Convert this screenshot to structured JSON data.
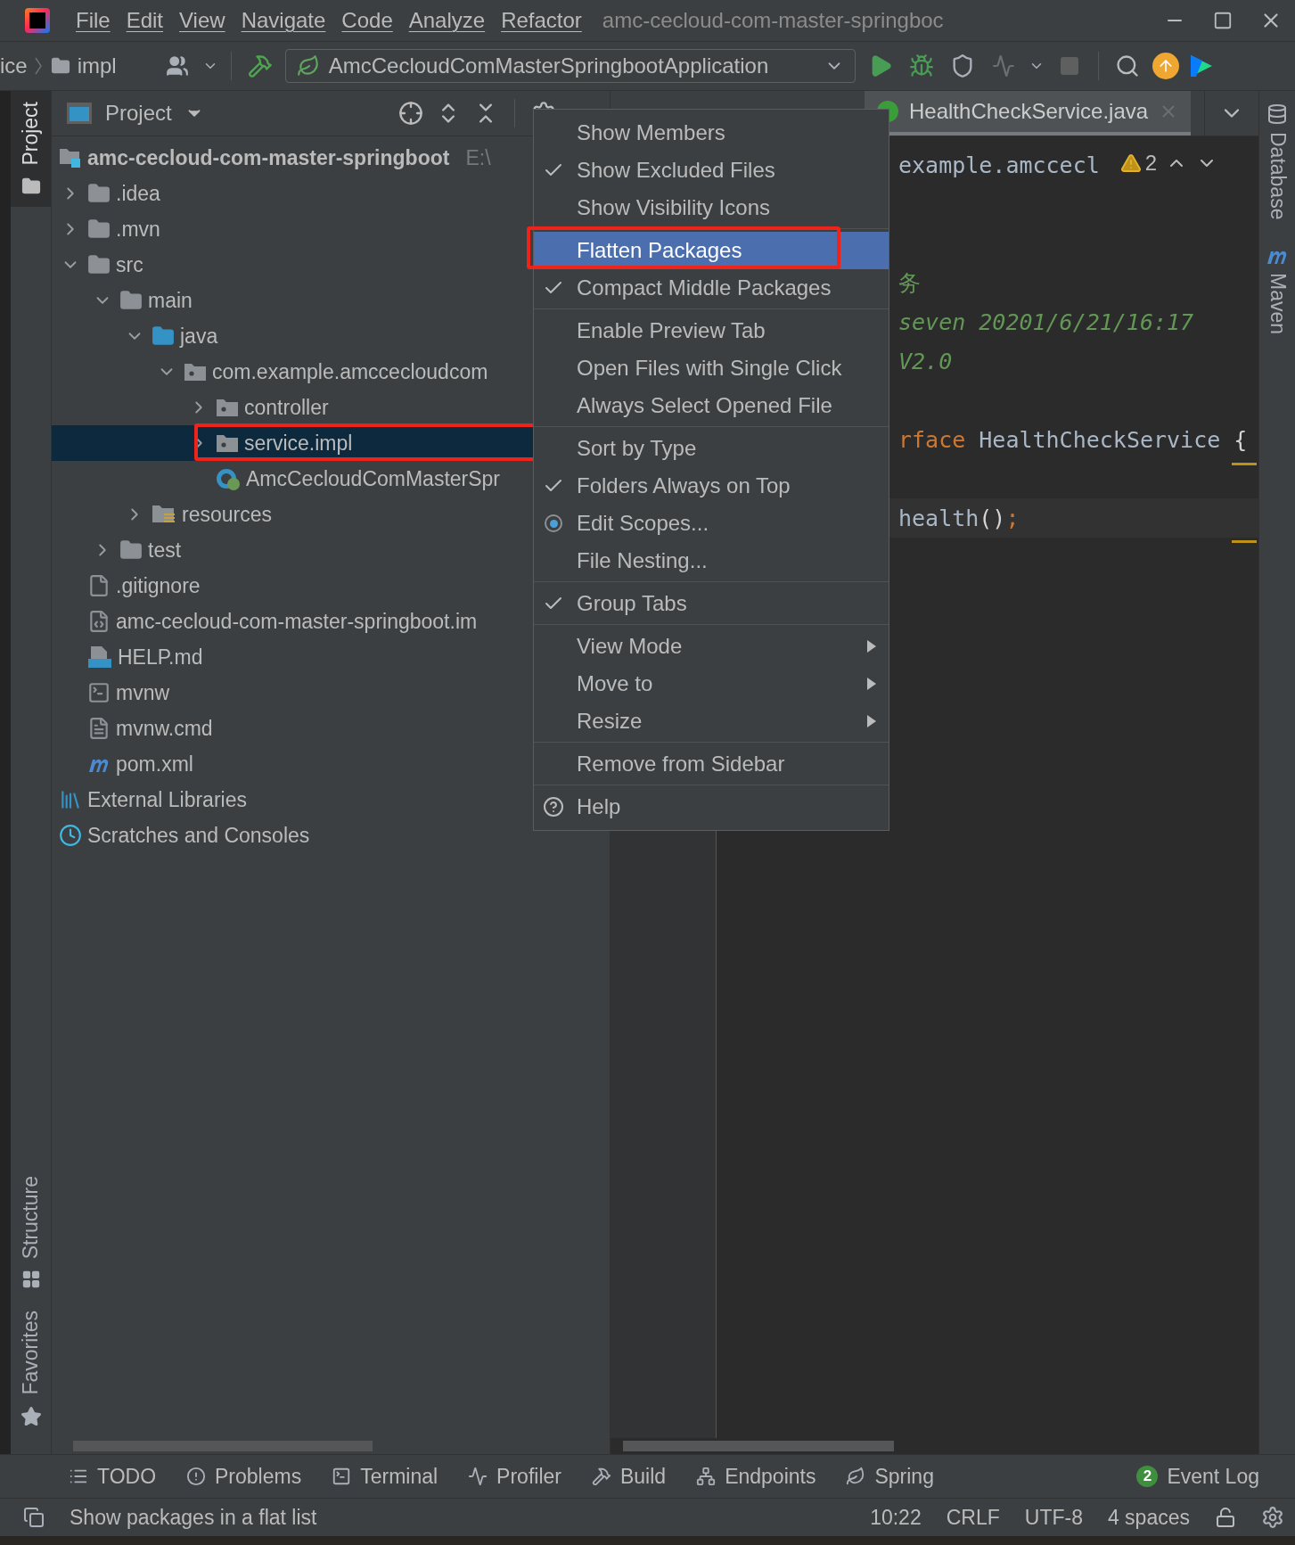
{
  "title_bar": {
    "menus": [
      "File",
      "Edit",
      "View",
      "Navigate",
      "Code",
      "Analyze",
      "Refactor"
    ],
    "title": "amc-cecloud-com-master-springboc"
  },
  "toolbar": {
    "breadcrumbs": [
      "ice",
      "impl"
    ],
    "run_configuration": "AmcCecloudComMasterSpringbootApplication"
  },
  "left_stripe": [
    {
      "label": "Project",
      "kind": "project",
      "selected": true
    },
    {
      "label": "Structure",
      "kind": "structure",
      "selected": false
    },
    {
      "label": "Favorites",
      "kind": "favorites",
      "selected": false
    }
  ],
  "project_panel": {
    "title": "Project",
    "tree": [
      {
        "label": "amc-cecloud-com-master-springboot",
        "hint": "E:\\",
        "kind": "project",
        "selected": false,
        "highlighted": false,
        "children": [
          {
            "label": ".idea",
            "kind": "folder",
            "expanded": false,
            "selected": false,
            "highlighted": false
          },
          {
            "label": ".mvn",
            "kind": "folder",
            "expanded": false,
            "selected": false,
            "highlighted": false
          },
          {
            "label": "src",
            "kind": "folder",
            "expanded": true,
            "selected": false,
            "highlighted": false,
            "children": [
              {
                "label": "main",
                "kind": "folder",
                "expanded": true,
                "selected": false,
                "highlighted": false,
                "children": [
                  {
                    "label": "java",
                    "kind": "source",
                    "expanded": true,
                    "selected": false,
                    "highlighted": false,
                    "children": [
                      {
                        "label": "com.example.amccecloudcom",
                        "kind": "package",
                        "expanded": true,
                        "selected": false,
                        "highlighted": false,
                        "children": [
                          {
                            "label": "controller",
                            "kind": "package",
                            "expanded": false,
                            "selected": false,
                            "highlighted": false
                          },
                          {
                            "label": "service.impl",
                            "kind": "package",
                            "expanded": false,
                            "selected": true,
                            "highlighted": true
                          },
                          {
                            "label": "AmcCecloudComMasterSpr",
                            "kind": "class",
                            "selected": false,
                            "highlighted": false
                          }
                        ]
                      }
                    ]
                  },
                  {
                    "label": "resources",
                    "kind": "resources",
                    "expanded": false,
                    "selected": false,
                    "highlighted": false
                  }
                ]
              },
              {
                "label": "test",
                "kind": "folder",
                "expanded": false,
                "selected": false,
                "highlighted": false
              }
            ]
          },
          {
            "label": ".gitignore",
            "kind": "file",
            "selected": false,
            "highlighted": false
          },
          {
            "label": "amc-cecloud-com-master-springboot.im",
            "kind": "module",
            "selected": false,
            "highlighted": false
          },
          {
            "label": "HELP.md",
            "kind": "markdown",
            "selected": false,
            "highlighted": false
          },
          {
            "label": "mvnw",
            "kind": "script",
            "selected": false,
            "highlighted": false
          },
          {
            "label": "mvnw.cmd",
            "kind": "text",
            "selected": false,
            "highlighted": false
          },
          {
            "label": "pom.xml",
            "kind": "maven",
            "selected": false,
            "highlighted": false
          }
        ]
      },
      {
        "label": "External Libraries",
        "kind": "libraries",
        "selected": false,
        "highlighted": false
      },
      {
        "label": "Scratches and Consoles",
        "kind": "scratches",
        "selected": false,
        "highlighted": false
      }
    ]
  },
  "context_menu": {
    "groups": [
      {
        "items": [
          {
            "label": "Show Members",
            "kind": "toggle",
            "checked": false,
            "selected": false,
            "highlighted": false
          },
          {
            "label": "Show Excluded Files",
            "kind": "toggle",
            "checked": true,
            "selected": false,
            "highlighted": false
          },
          {
            "label": "Show Visibility Icons",
            "kind": "toggle",
            "checked": false,
            "selected": false,
            "highlighted": false
          }
        ]
      },
      {
        "items": [
          {
            "label": "Flatten Packages",
            "kind": "toggle",
            "checked": false,
            "selected": true,
            "highlighted": true
          },
          {
            "label": "Compact Middle Packages",
            "kind": "toggle",
            "checked": true,
            "selected": false,
            "highlighted": false
          }
        ]
      },
      {
        "items": [
          {
            "label": "Enable Preview Tab",
            "kind": "toggle",
            "checked": false,
            "selected": false,
            "highlighted": false
          },
          {
            "label": "Open Files with Single Click",
            "kind": "toggle",
            "checked": false,
            "selected": false,
            "highlighted": false
          },
          {
            "label": "Always Select Opened File",
            "kind": "toggle",
            "checked": false,
            "selected": false,
            "highlighted": false
          }
        ]
      },
      {
        "items": [
          {
            "label": "Sort by Type",
            "kind": "toggle",
            "checked": false,
            "selected": false,
            "highlighted": false
          },
          {
            "label": "Folders Always on Top",
            "kind": "toggle",
            "checked": true,
            "selected": false,
            "highlighted": false
          },
          {
            "label": "Edit Scopes...",
            "kind": "scope",
            "selected": false,
            "highlighted": false
          },
          {
            "label": "File Nesting...",
            "kind": "action",
            "selected": false,
            "highlighted": false
          }
        ]
      },
      {
        "items": [
          {
            "label": "Group Tabs",
            "kind": "toggle",
            "checked": true,
            "selected": false,
            "highlighted": false
          }
        ]
      },
      {
        "items": [
          {
            "label": "View Mode",
            "kind": "submenu",
            "selected": false,
            "highlighted": false
          },
          {
            "label": "Move to",
            "kind": "submenu",
            "selected": false,
            "highlighted": false
          },
          {
            "label": "Resize",
            "kind": "submenu",
            "selected": false,
            "highlighted": false
          }
        ]
      },
      {
        "items": [
          {
            "label": "Remove from Sidebar",
            "kind": "action",
            "selected": false,
            "highlighted": false
          }
        ]
      },
      {
        "items": [
          {
            "label": "Help",
            "kind": "help",
            "selected": false,
            "highlighted": false
          }
        ]
      }
    ]
  },
  "editor": {
    "tabs": [
      {
        "label": "HealthCheckService.java",
        "selected": true
      }
    ],
    "inspection": {
      "count": "2"
    },
    "lines": [
      {
        "kind": "code",
        "segments": [
          {
            "text": "example.amccecl",
            "kind": "plain"
          }
        ]
      },
      {
        "kind": "blank"
      },
      {
        "kind": "blank"
      },
      {
        "kind": "code",
        "segments": [
          {
            "text": "务",
            "kind": "comment"
          }
        ]
      },
      {
        "kind": "code",
        "segments": [
          {
            "text": "seven 20201/6/21/16:17",
            "kind": "doc"
          }
        ]
      },
      {
        "kind": "code",
        "segments": [
          {
            "text": "V2.0",
            "kind": "doc"
          }
        ]
      },
      {
        "kind": "blank"
      },
      {
        "kind": "code",
        "segments": [
          {
            "text": "rface",
            "kind": "keyword"
          },
          {
            "text": " HealthCheckService ",
            "kind": "plain"
          },
          {
            "text": "{",
            "kind": "brace"
          }
        ]
      },
      {
        "kind": "blank"
      }
    ],
    "caret_line": {
      "segments": [
        {
          "text": "health",
          "kind": "plain"
        },
        {
          "text": "()",
          "kind": "brace"
        },
        {
          "text": ";",
          "kind": "keyword"
        }
      ]
    }
  },
  "right_stripe": [
    {
      "label": "Database",
      "kind": "database"
    },
    {
      "label": "Maven",
      "kind": "maven"
    }
  ],
  "tool_windows": [
    {
      "label": "TODO",
      "kind": "todo"
    },
    {
      "label": "Problems",
      "kind": "problems"
    },
    {
      "label": "Terminal",
      "kind": "terminal"
    },
    {
      "label": "Profiler",
      "kind": "profiler"
    },
    {
      "label": "Build",
      "kind": "build"
    },
    {
      "label": "Endpoints",
      "kind": "endpoints"
    },
    {
      "label": "Spring",
      "kind": "spring"
    },
    {
      "label": "Event Log",
      "kind": "event-log",
      "badge": "2"
    }
  ],
  "status_bar": {
    "message": "Show packages in a flat list",
    "items": [
      "10:22",
      "CRLF",
      "UTF-8",
      "4 spaces"
    ]
  }
}
